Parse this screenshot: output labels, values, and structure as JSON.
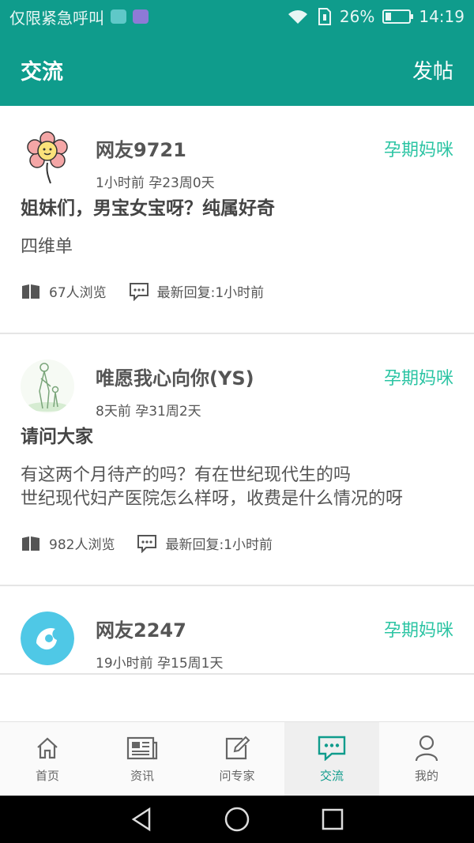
{
  "status_bar": {
    "carrier": "仅限紧急呼叫",
    "battery": "26%",
    "battery_level": 0.26,
    "time": "14:19"
  },
  "header": {
    "title": "交流",
    "post_label": "发帖"
  },
  "posts": [
    {
      "username": "网友9721",
      "meta": "1小时前 孕23周0天",
      "tag": "孕期妈咪",
      "title": "姐妹们，男宝女宝呀？纯属好奇",
      "body": "四维单",
      "views": "67人浏览",
      "last_reply": "最新回复:1小时前"
    },
    {
      "username": "唯愿我心向你(YS)",
      "meta": "8天前 孕31周2天",
      "tag": "孕期妈咪",
      "title": "请问大家",
      "body": "有这两个月待产的吗？有在世纪现代生的吗\n世纪现代妇产医院怎么样呀，收费是什么情况的呀",
      "views": "982人浏览",
      "last_reply": "最新回复:1小时前"
    },
    {
      "username": "网友2247",
      "meta": "19小时前 孕15周1天",
      "tag": "孕期妈咪"
    }
  ],
  "tabs": [
    {
      "label": "首页",
      "icon": "home-icon"
    },
    {
      "label": "资讯",
      "icon": "news-icon"
    },
    {
      "label": "问专家",
      "icon": "edit-icon"
    },
    {
      "label": "交流",
      "icon": "chat-icon",
      "active": true
    },
    {
      "label": "我的",
      "icon": "user-icon"
    }
  ],
  "colors": {
    "primary": "#0f9c8c",
    "tag": "#2bc4a3"
  }
}
